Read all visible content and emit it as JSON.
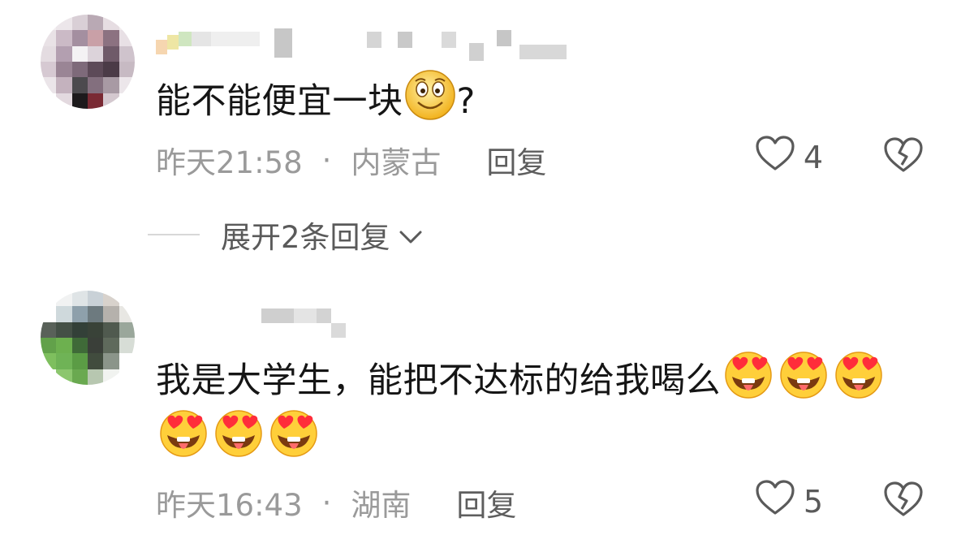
{
  "comments": [
    {
      "text": "能不能便宜一块",
      "suffix": "?",
      "time": "昨天21:58",
      "separator": "·",
      "location": "内蒙古",
      "reply_label": "回复",
      "likes": "4",
      "emoji": "smile-emoji"
    },
    {
      "text": "我是大学生，能把不达标的给我喝么",
      "time": "昨天16:43",
      "separator": "·",
      "location": "湖南",
      "reply_label": "回复",
      "likes": "5",
      "emoji": "heart-eyes-tongue-emoji",
      "emoji_count": 6
    }
  ],
  "expand_replies_label": "展开2条回复",
  "icons": {
    "like": "heart-outline-icon",
    "dislike": "broken-heart-icon",
    "expand": "chevron-down-icon"
  },
  "colors": {
    "text": "#151515",
    "meta": "#9a9a9a",
    "action": "#5a5a5a"
  }
}
